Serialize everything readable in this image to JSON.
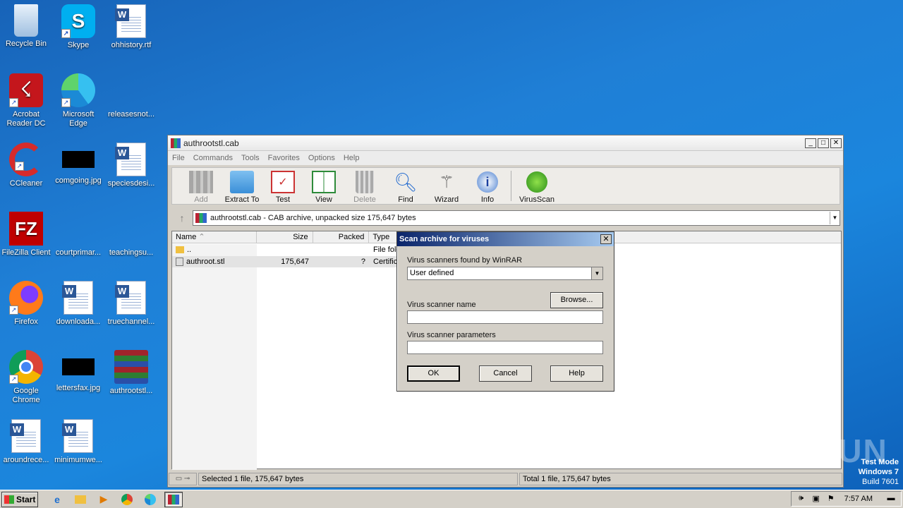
{
  "desktop": {
    "icons": [
      {
        "label": "Recycle Bin"
      },
      {
        "label": "Skype"
      },
      {
        "label": "ohhistory.rtf"
      },
      {
        "label": "Acrobat Reader DC"
      },
      {
        "label": "Microsoft Edge"
      },
      {
        "label": "releasesnot..."
      },
      {
        "label": "CCleaner"
      },
      {
        "label": "comgoing.jpg"
      },
      {
        "label": "speciesdesi..."
      },
      {
        "label": "FileZilla Client"
      },
      {
        "label": "courtprimar..."
      },
      {
        "label": "teachingsu..."
      },
      {
        "label": "Firefox"
      },
      {
        "label": "downloada..."
      },
      {
        "label": "truechannel..."
      },
      {
        "label": "Google Chrome"
      },
      {
        "label": "lettersfax.jpg"
      },
      {
        "label": "authrootstl..."
      },
      {
        "label": "aroundrece..."
      },
      {
        "label": "minimumwe..."
      }
    ]
  },
  "window": {
    "title": "authrootstl.cab",
    "menu": [
      "File",
      "Commands",
      "Tools",
      "Favorites",
      "Options",
      "Help"
    ],
    "toolbar": [
      {
        "label": "Add",
        "icon": "add-icon",
        "disabled": true
      },
      {
        "label": "Extract To",
        "icon": "extract-folder-icon",
        "disabled": false
      },
      {
        "label": "Test",
        "icon": "test-checklist-icon",
        "disabled": false
      },
      {
        "label": "View",
        "icon": "view-book-icon",
        "disabled": false
      },
      {
        "label": "Delete",
        "icon": "trash-icon",
        "disabled": true
      },
      {
        "label": "Find",
        "icon": "magnifier-icon",
        "disabled": false
      },
      {
        "label": "Wizard",
        "icon": "wand-icon",
        "disabled": false
      },
      {
        "label": "Info",
        "icon": "info-icon",
        "disabled": false
      },
      {
        "label": "VirusScan",
        "icon": "virus-icon",
        "disabled": false
      }
    ],
    "address": "authrootstl.cab - CAB archive, unpacked size 175,647 bytes",
    "columns": [
      "Name",
      "Size",
      "Packed",
      "Type"
    ],
    "rows": [
      {
        "name": "..",
        "size": "",
        "packed": "",
        "type": "File folc"
      },
      {
        "name": "authroot.stl",
        "size": "175,647",
        "packed": "?",
        "type": "Certific"
      }
    ],
    "status_left": "Selected 1 file, 175,647 bytes",
    "status_right": "Total 1 file, 175,647 bytes"
  },
  "dialog": {
    "title": "Scan archive for viruses",
    "scanners_label": "Virus scanners found by WinRAR",
    "scanner_selected": "User defined",
    "browse": "Browse...",
    "name_label": "Virus scanner name",
    "name_value": "",
    "params_label": "Virus scanner parameters",
    "params_value": "",
    "ok": "OK",
    "cancel": "Cancel",
    "help": "Help"
  },
  "taskbar": {
    "start": "Start",
    "time": "7:57 AM"
  },
  "watermark": "ANY RUN",
  "testmode": {
    "line1": "Test Mode",
    "line2": "Windows 7",
    "line3": "Build 7601"
  }
}
